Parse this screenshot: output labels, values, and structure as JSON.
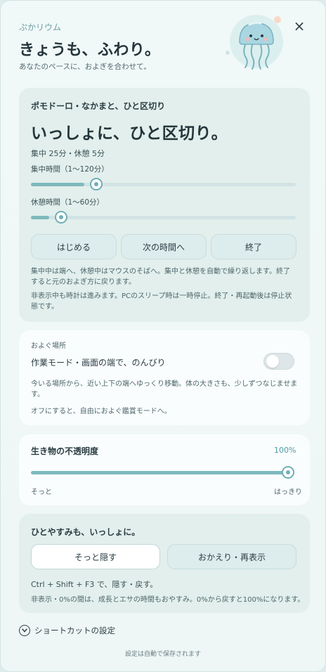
{
  "header": {
    "app_name": "ぷかリウム",
    "headline": "きょうも、ふわり。",
    "tagline": "あなたのペースに、およぎを合わせて。",
    "close_label": "×"
  },
  "pomodoro": {
    "section_title": "ポモドーロ・なかまと、ひと区切り",
    "big_title": "いっしょに、ひと区切り。",
    "summary": "集中 25分・休憩 5分",
    "focus": {
      "label": "集中時間（1〜120分）",
      "value": 25,
      "min": 1,
      "max": 120
    },
    "break": {
      "label": "休憩時間（1〜60分）",
      "value": 5,
      "min": 1,
      "max": 60
    },
    "buttons": {
      "start": "はじめる",
      "next": "次の時間へ",
      "end": "終了"
    },
    "note1": "集中中は端へ、休憩中はマウスのそばへ。集中と休憩を自動で繰り返します。終了すると元のおよぎ方に戻ります。",
    "note2": "非表示中も時計は進みます。PCのスリープ時は一時停止。終了・再起動後は停止状態です。"
  },
  "swim": {
    "section_label": "およぐ場所",
    "mode_label": "作業モード・画面の端で、のんびり",
    "toggle_on": false,
    "desc1": "今いる場所から、近い上下の端へゆっくり移動。体の大きさも、少しずつなじませます。",
    "desc2": "オフにすると、自由におよぐ鑑賞モードへ。"
  },
  "opacity": {
    "title": "生き物の不透明度",
    "value_label": "100%",
    "value": 100,
    "min_label": "そっと",
    "max_label": "はっきり"
  },
  "hide": {
    "title": "ひとやすみも、いっしょに。",
    "hide_button": "そっと隠す",
    "show_button": "おかえり・再表示",
    "shortcut_text": "Ctrl + Shift + F3 で、隠す・戻す。",
    "note": "非表示・0%の間は、成長とエサの時間もおやすみ。0%から戻すと100%になります。"
  },
  "shortcut_settings_label": "ショートカットの設定",
  "footer": "設定は自動で保存されます",
  "colors": {
    "accent": "#6fb0b6",
    "card_tint": "#e2efec",
    "background": "#eef6f6"
  }
}
